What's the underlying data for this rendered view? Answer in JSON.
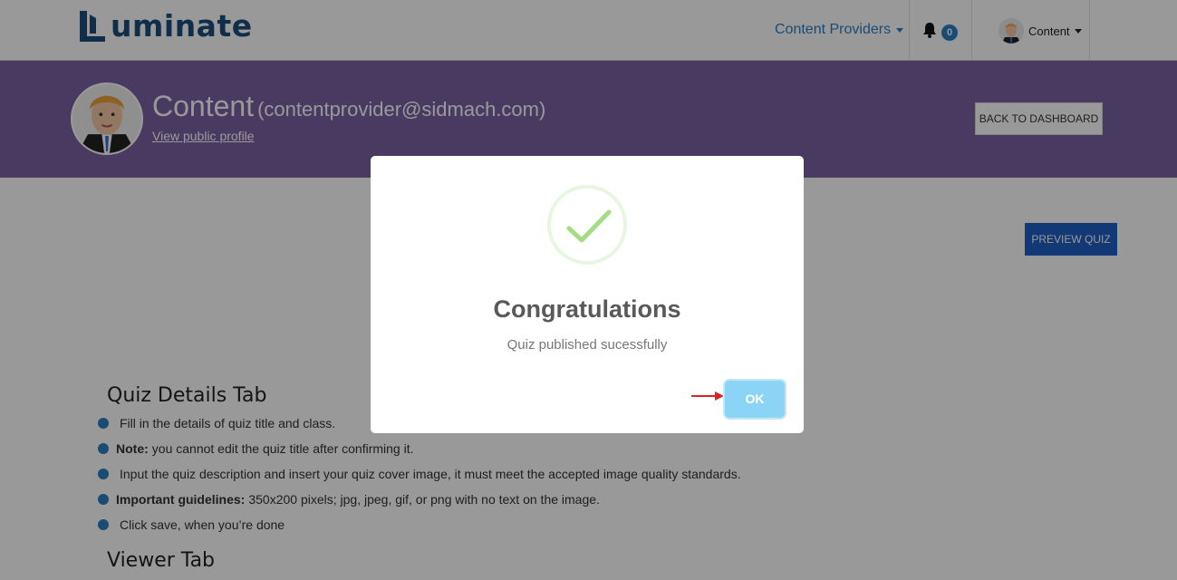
{
  "header": {
    "logo_text": "uminate",
    "nav_providers": "Content Providers",
    "notifications_count": "0",
    "user_label": "Content"
  },
  "profile": {
    "name": "Content",
    "email": "(contentprovider@sidmach.com)",
    "public_link": "View public profile",
    "back_button": "BACK TO DASHBOARD"
  },
  "main": {
    "preview_button": "PREVIEW QUIZ",
    "quiz_details_title": "Quiz Details Tab",
    "items": [
      {
        "bold": "",
        "text": "Fill in the details of quiz title and class."
      },
      {
        "bold": "Note:",
        "text": "you cannot edit the quiz title after confirming it."
      },
      {
        "bold": "",
        "text": "Input the quiz description and insert your quiz cover image, it must meet the accepted image quality standards."
      },
      {
        "bold": "Important guidelines:",
        "text": "350x200 pixels; jpg, jpeg, gif, or png with no text on the image."
      },
      {
        "bold": "",
        "text": "Click save, when you’re done"
      }
    ],
    "viewer_tab_title": "Viewer Tab"
  },
  "modal": {
    "title": "Congratulations",
    "message": "Quiz published sucessfully",
    "ok_button": "OK",
    "success_color": "#a5dc86"
  },
  "colors": {
    "brand": "#1b4e7c",
    "link": "#2a7fc0",
    "banner": "#7b62a3",
    "preview_button": "#1e5ec4"
  },
  "icons": {
    "bell": "bell-icon",
    "check": "checkmark-icon",
    "arrow": "red-arrow-icon"
  }
}
